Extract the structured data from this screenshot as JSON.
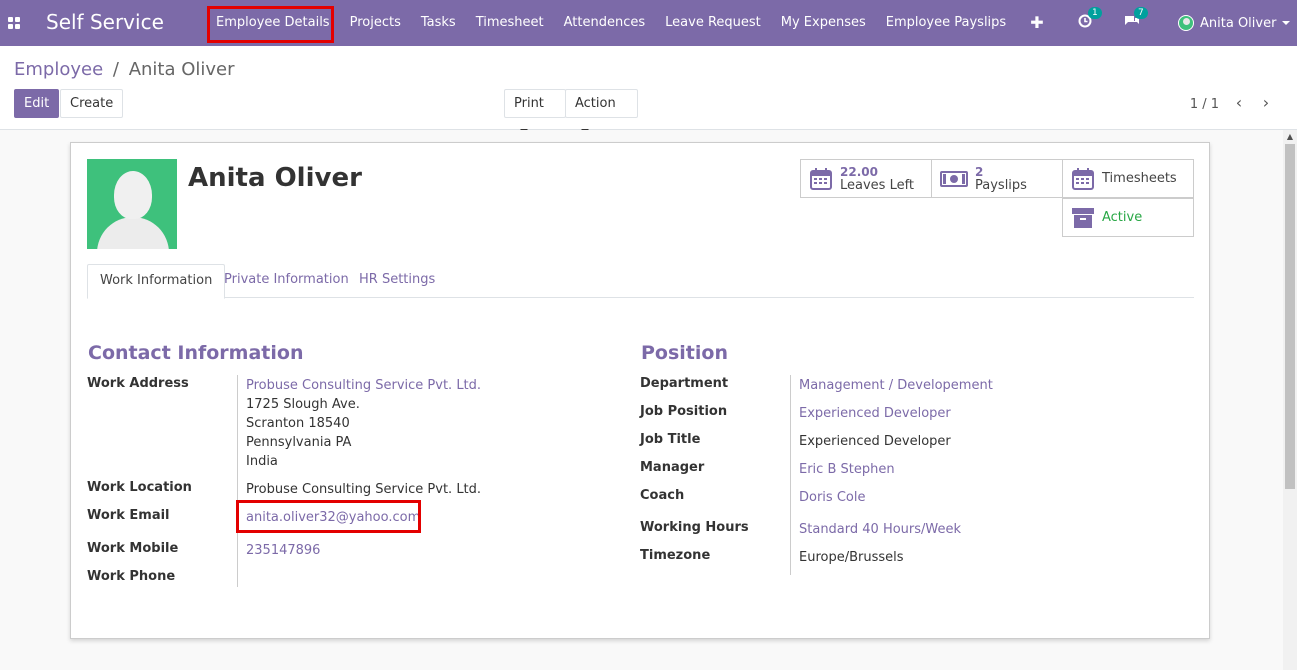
{
  "navbar": {
    "brand": "Self Service",
    "menu": [
      "Employee Details",
      "Projects",
      "Tasks",
      "Timesheet",
      "Attendences",
      "Leave Request",
      "My Expenses",
      "Employee Payslips"
    ],
    "plus": "✚",
    "activity_count": "1",
    "messages_count": "7",
    "user_name": "Anita Oliver"
  },
  "control": {
    "breadcrumb_parent": "Employee",
    "breadcrumb_sep": "/",
    "breadcrumb_current": "Anita Oliver",
    "edit_label": "Edit",
    "create_label": "Create",
    "print_label": "Print",
    "action_label": "Action",
    "pager": "1 / 1"
  },
  "employee": {
    "name": "Anita Oliver"
  },
  "smart_buttons": {
    "leaves_value": "22.00",
    "leaves_label": "Leaves Left",
    "payslips_value": "2",
    "payslips_label": "Payslips",
    "timesheets_label": "Timesheets",
    "active_label": "Active"
  },
  "tabs": [
    "Work Information",
    "Private Information",
    "HR Settings"
  ],
  "contact": {
    "title": "Contact Information",
    "work_address_label": "Work Address",
    "work_address": [
      "Probuse Consulting Service Pvt. Ltd.",
      "1725 Slough Ave.",
      "Scranton 18540",
      "Pennsylvania PA",
      "India"
    ],
    "work_location_label": "Work Location",
    "work_location": "Probuse Consulting Service Pvt. Ltd.",
    "work_email_label": "Work Email",
    "work_email": "anita.oliver32@yahoo.com",
    "work_mobile_label": "Work Mobile",
    "work_mobile": "235147896",
    "work_phone_label": "Work Phone"
  },
  "position": {
    "title": "Position",
    "department_label": "Department",
    "department": "Management / Developement",
    "job_position_label": "Job Position",
    "job_position": "Experienced Developer",
    "job_title_label": "Job Title",
    "job_title": "Experienced Developer",
    "manager_label": "Manager",
    "manager": "Eric B Stephen",
    "coach_label": "Coach",
    "coach": "Doris Cole",
    "working_hours_label": "Working Hours",
    "working_hours": "Standard 40 Hours/Week",
    "timezone_label": "Timezone",
    "timezone": "Europe/Brussels"
  },
  "colors": {
    "brand": "#7c6aa8",
    "highlight": "#e30000",
    "active": "#28a745"
  }
}
